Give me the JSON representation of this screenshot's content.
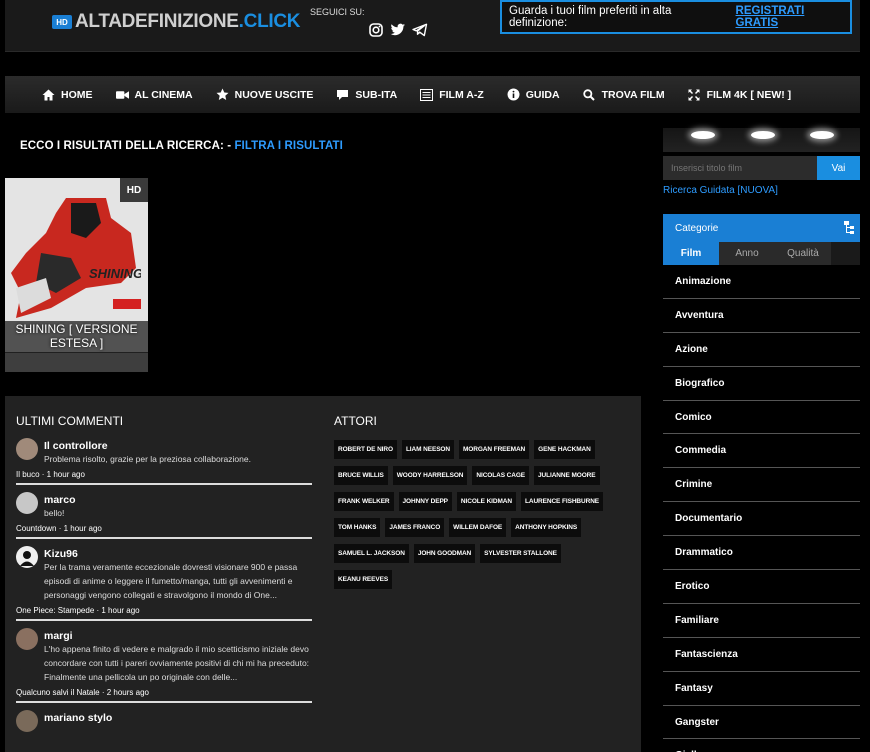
{
  "header": {
    "logo_badge": "HD",
    "logo_main": "ALTADEFINIZIONE",
    "logo_tld": ".CLICK",
    "follow_label": "SEGUICI SU:",
    "social_icons": [
      "instagram-icon",
      "twitter-icon",
      "telegram-icon"
    ],
    "promo_text": "Guarda i tuoi film preferiti in alta definizione:",
    "promo_link": "REGISTRATI GRATIS"
  },
  "nav": {
    "items": [
      {
        "label": "HOME",
        "icon": "home-icon"
      },
      {
        "label": "AL CINEMA",
        "icon": "video-camera-icon"
      },
      {
        "label": "NUOVE USCITE",
        "icon": "star-icon"
      },
      {
        "label": "SUB-ITA",
        "icon": "speech-bubble-icon"
      },
      {
        "label": "FILM A-Z",
        "icon": "list-icon"
      },
      {
        "label": "GUIDA",
        "icon": "info-icon"
      },
      {
        "label": "TROVA FILM",
        "icon": "search-icon"
      },
      {
        "label": "FILM 4K [ NEW! ]",
        "icon": "expand-icon"
      }
    ]
  },
  "results": {
    "title": "ECCO I RISULTATI DELLA RICERCA: -",
    "filter_link": "FILTRA I RISULTATI",
    "movie": {
      "badge": "HD",
      "title": "SHINING [ VERSIONE ESTESA ]",
      "poster_text": "SHINING"
    }
  },
  "comments": {
    "heading": "ULTIMI COMMENTI",
    "items": [
      {
        "author": "Il controllore",
        "text": "Problema risolto, grazie per la preziosa collaborazione.",
        "meta": "Il buco · 1 hour ago"
      },
      {
        "author": "marco",
        "text": "bello!",
        "meta": "Countdown · 1 hour ago"
      },
      {
        "author": "Kizu96",
        "text": "Per la trama veramente eccezionale dovresti visionare 900 e passa episodi di anime o leggere il fumetto/manga, tutti gli avvenimenti e personaggi vengono collegati e stravolgono il mondo di One...",
        "meta": "One Piece: Stampede · 1 hour ago"
      },
      {
        "author": "margi",
        "text": "L'ho appena finito di vedere e malgrado il mio scetticismo iniziale devo concordare con tutti i pareri ovviamente positivi di chi mi ha preceduto: Finalmente una pellicola un po originale con delle...",
        "meta": "Qualcuno salvi il Natale · 2 hours ago"
      },
      {
        "author": "mariano stylo",
        "text": "",
        "meta": ""
      }
    ]
  },
  "actors": {
    "heading": "ATTORI",
    "items": [
      "ROBERT DE NIRO",
      "LIAM NEESON",
      "MORGAN FREEMAN",
      "GENE HACKMAN",
      "BRUCE WILLIS",
      "WOODY HARRELSON",
      "NICOLAS CAGE",
      "JULIANNE MOORE",
      "FRANK WELKER",
      "JOHNNY DEPP",
      "NICOLE KIDMAN",
      "LAURENCE FISHBURNE",
      "TOM HANKS",
      "JAMES FRANCO",
      "WILLEM DAFOE",
      "ANTHONY HOPKINS",
      "SAMUEL L. JACKSON",
      "JOHN GOODMAN",
      "SYLVESTER STALLONE",
      "KEANU REEVES"
    ]
  },
  "sidebar": {
    "search_placeholder": "Inserisci titolo film",
    "search_button": "Vai",
    "guided_link": "Ricerca Guidata [NUOVA]",
    "categories_title": "Categorie",
    "tabs": [
      "Film",
      "Anno",
      "Qualità"
    ],
    "categories": [
      "Animazione",
      "Avventura",
      "Azione",
      "Biografico",
      "Comico",
      "Commedia",
      "Crimine",
      "Documentario",
      "Drammatico",
      "Erotico",
      "Familiare",
      "Fantascienza",
      "Fantasy",
      "Gangster",
      "Giallo"
    ]
  },
  "colors": {
    "accent": "#1a8ee0",
    "link": "#2e9cff",
    "background": "#000000",
    "panel": "#222222"
  }
}
